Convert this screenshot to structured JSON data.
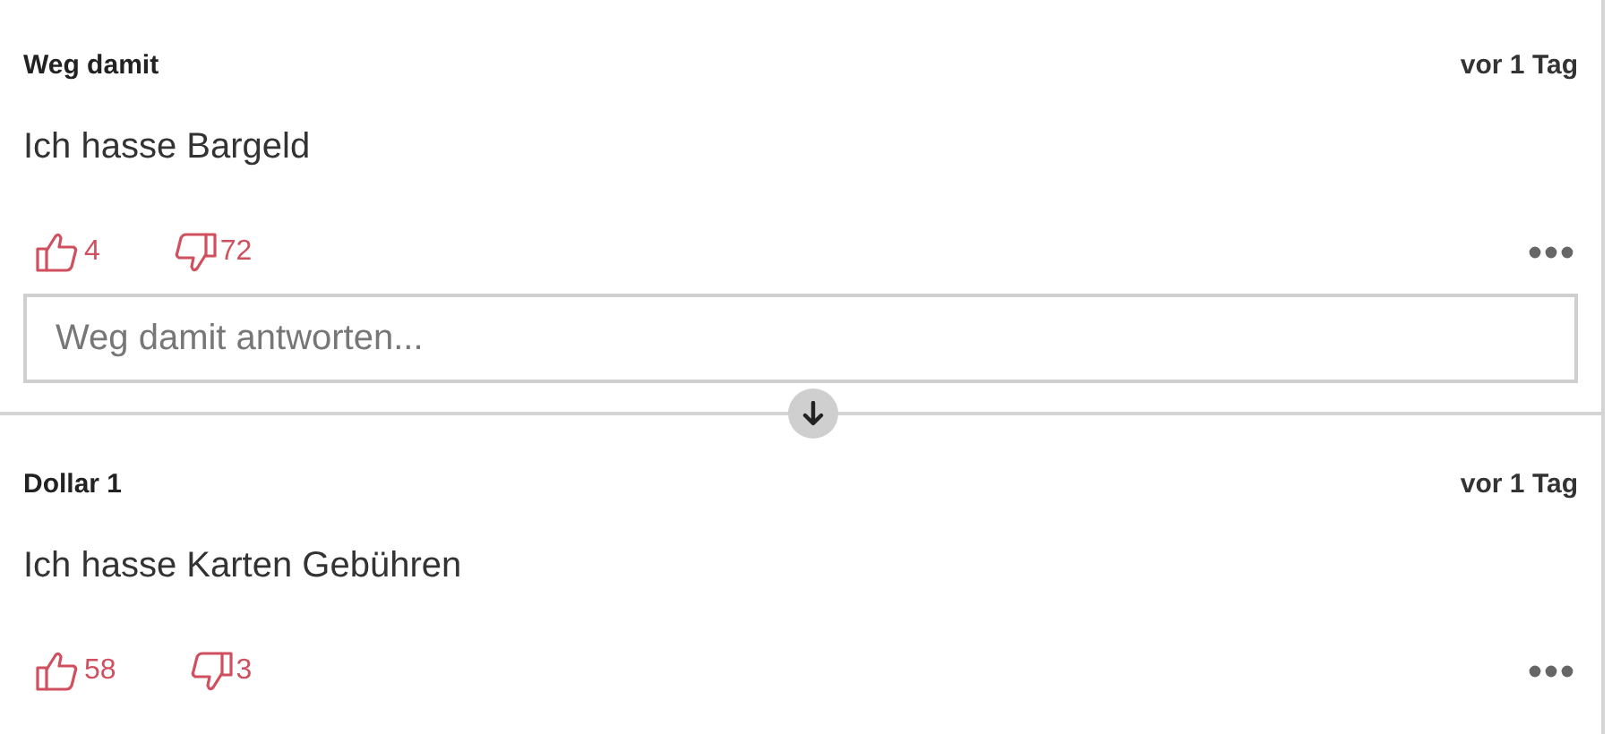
{
  "comments": [
    {
      "author": "Weg damit",
      "time": "vor 1 Tag",
      "text": "Ich hasse Bargeld",
      "likes": "4",
      "dislikes": "72",
      "reply": {
        "placeholder": "Weg damit antworten..."
      }
    },
    {
      "author": "Dollar 1",
      "time": "vor 1 Tag",
      "text": "Ich hasse Karten Gebühren",
      "likes": "58",
      "dislikes": "3"
    }
  ]
}
